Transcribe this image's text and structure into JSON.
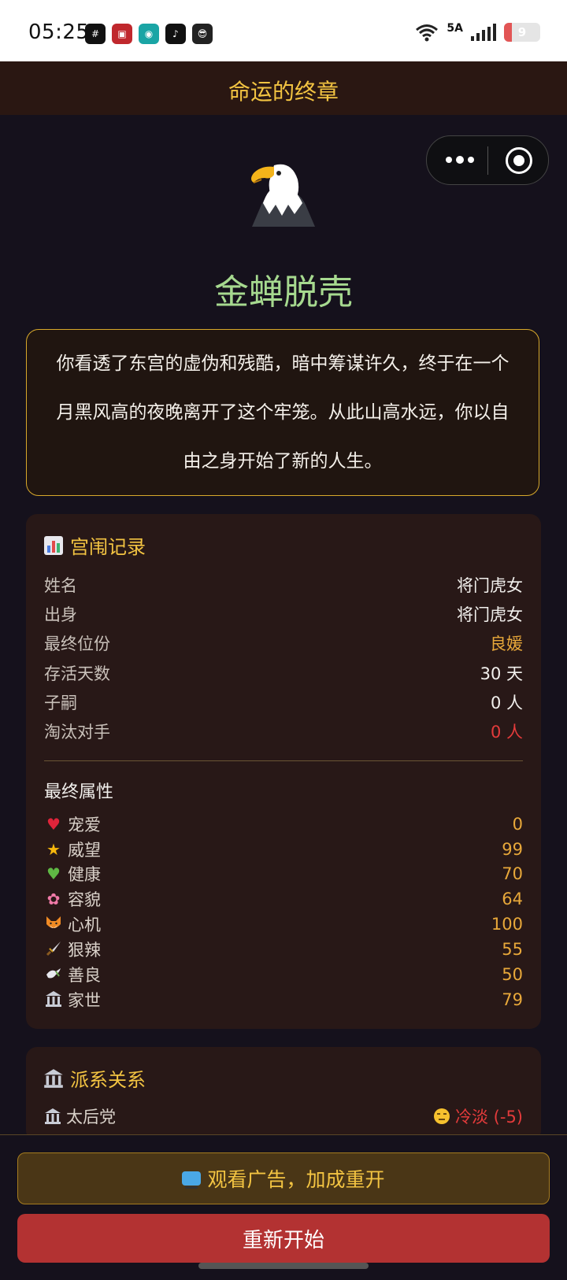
{
  "status": {
    "time": "05:25",
    "network": "5A",
    "battery": "9",
    "battery_level": 0.09,
    "notification_icons": [
      "grid-app-icon",
      "video-app-icon",
      "chat-app-icon",
      "tiktok-icon",
      "sunglasses-app-icon"
    ]
  },
  "nav": {
    "title": "命运的终章"
  },
  "ending": {
    "icon": "eagle-icon",
    "title": "金蝉脱壳",
    "description": "你看透了东宫的虚伪和残酷，暗中筹谋许久，终于在一个月黑风高的夜晚离开了这个牢笼。从此山高水远，你以自由之身开始了新的人生。"
  },
  "record": {
    "icon": "bar-chart-icon",
    "title": "宫闱记录",
    "rows": [
      {
        "label": "姓名",
        "value": "将门虎女"
      },
      {
        "label": "出身",
        "value": "将门虎女"
      },
      {
        "label": "最终位份",
        "value": "良媛"
      },
      {
        "label": "存活天数",
        "value": "30 天"
      },
      {
        "label": "子嗣",
        "value": "0 人"
      },
      {
        "label": "淘汰对手",
        "value": "0 人"
      }
    ],
    "attr_title": "最终属性",
    "attributes": [
      {
        "icon": "heart-icon",
        "label": "宠爱",
        "value": "0"
      },
      {
        "icon": "star-icon",
        "label": "威望",
        "value": "99"
      },
      {
        "icon": "green-heart-icon",
        "label": "健康",
        "value": "70"
      },
      {
        "icon": "flower-icon",
        "label": "容貌",
        "value": "64"
      },
      {
        "icon": "fox-icon",
        "label": "心机",
        "value": "100"
      },
      {
        "icon": "dagger-icon",
        "label": "狠辣",
        "value": "55"
      },
      {
        "icon": "dove-icon",
        "label": "善良",
        "value": "50"
      },
      {
        "icon": "temple-icon",
        "label": "家世",
        "value": "79"
      }
    ]
  },
  "factions": {
    "icon": "temple-icon",
    "title": "派系关系",
    "rows": [
      {
        "icon": "temple-icon",
        "label": "太后党",
        "status_icon": "unamused-face-icon",
        "value": "冷淡 (-5)"
      }
    ]
  },
  "buttons": {
    "ad": "观看广告，加成重开",
    "restart": "重新开始"
  },
  "colors": {
    "gold": "#f3c442",
    "red": "#e33b3b",
    "green_title": "#a6d98f",
    "restart_bg": "#b33232"
  }
}
